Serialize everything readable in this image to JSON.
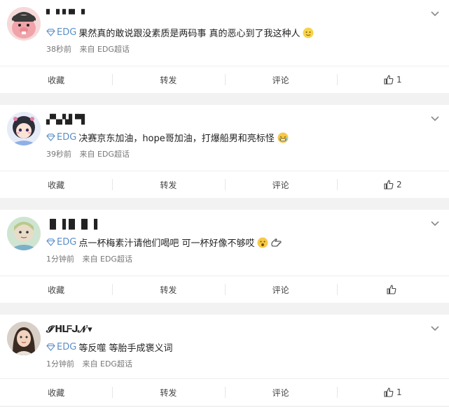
{
  "comments": [
    {
      "username": "▘▝▝▝▘▝",
      "badge": "EDG",
      "text": "果然真的敢说跟没素质是两码事 真的恶心到了我这种人",
      "time": "38秒前",
      "source": "来自 EDG超话",
      "actions": {
        "favorite": "收藏",
        "repost": "转发",
        "comment": "评论",
        "likes": "1"
      }
    },
    {
      "username": "▞▚▞▟▝▜",
      "badge": "EDG",
      "text": "决赛京东加油，hope哥加油，打爆船男和亮标怪",
      "time": "39秒前",
      "source": "来自 EDG超话",
      "actions": {
        "favorite": "收藏",
        "repost": "转发",
        "comment": "评论",
        "likes": "2"
      }
    },
    {
      "username": "▐▌▐▐▌▐▌▐",
      "badge": "EDG",
      "text": "点一杯梅素汁请他们喝吧 可一杯好像不够哎",
      "time": "1分钟前",
      "source": "来自 EDG超话",
      "actions": {
        "favorite": "收藏",
        "repost": "转发",
        "comment": "评论",
        "likes": ""
      }
    },
    {
      "username": "𝓘ᐟᕼᒪᖴᒍ𝓝ᐝ▾",
      "badge": "EDG",
      "text": "等反噬 等胎手成褒义词",
      "time": "1分钟前",
      "source": "来自 EDG超话",
      "actions": {
        "favorite": "收藏",
        "repost": "转发",
        "comment": "评论",
        "likes": "1"
      }
    }
  ]
}
